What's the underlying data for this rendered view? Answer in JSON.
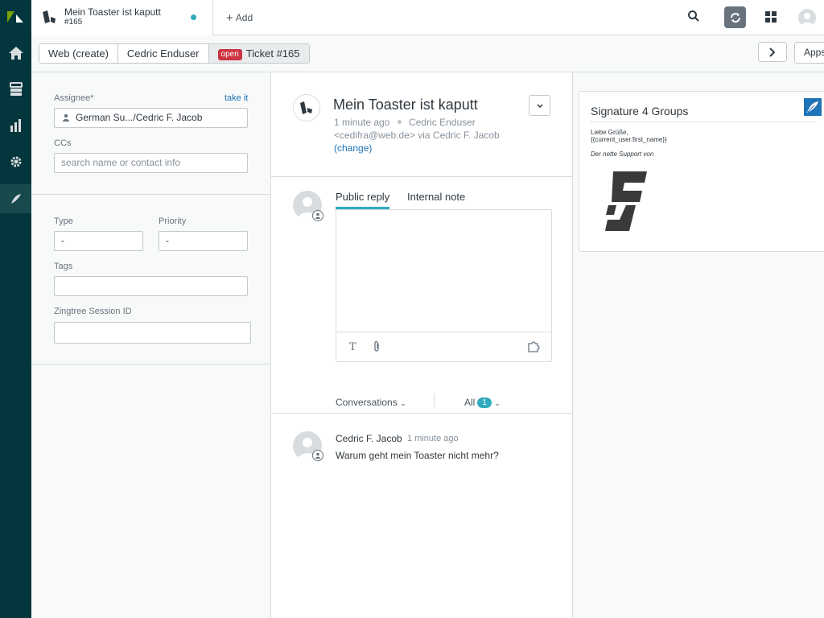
{
  "tab": {
    "title": "Mein Toaster ist kaputt",
    "subtitle": "#165"
  },
  "topbar": {
    "add_label": "Add"
  },
  "breadcrumb": {
    "items": [
      "Web (create)",
      "Cedric Enduser"
    ],
    "status_badge": "open",
    "ticket_label": "Ticket #165"
  },
  "apps_button": "Apps",
  "properties": {
    "assignee_label": "Assignee*",
    "take_it": "take it",
    "assignee_value": "German Su.../Cedric F. Jacob",
    "ccs_label": "CCs",
    "ccs_placeholder": "search name or contact info",
    "type_label": "Type",
    "type_value": "-",
    "priority_label": "Priority",
    "priority_value": "-",
    "tags_label": "Tags",
    "tags_value": "",
    "zingtree_label": "Zingtree Session ID",
    "zingtree_value": ""
  },
  "ticket": {
    "subject": "Mein Toaster ist kaputt",
    "time": "1 minute ago",
    "requester": "Cedric Enduser",
    "email_via": "<cedifra@web.de> via Cedric F. Jacob",
    "change_link": "(change)"
  },
  "reply": {
    "tabs": [
      "Public reply",
      "Internal note"
    ],
    "active_tab": "Public reply"
  },
  "conversation_filter": {
    "label": "Conversations",
    "all_label": "All",
    "count": "1"
  },
  "messages": [
    {
      "author": "Cedric F. Jacob",
      "time": "1 minute ago",
      "body": "Warum geht mein Toaster nicht mehr?"
    }
  ],
  "app": {
    "title": "Signature 4 Groups",
    "line1": "Liebe Grüße,",
    "line2": "{{current_user.first_name}}",
    "line3": "Der nette Support von"
  },
  "colors": {
    "nav_bg": "#03363d",
    "accent": "#30aabc",
    "link": "#1f73b7",
    "open_badge": "#cc3340"
  }
}
